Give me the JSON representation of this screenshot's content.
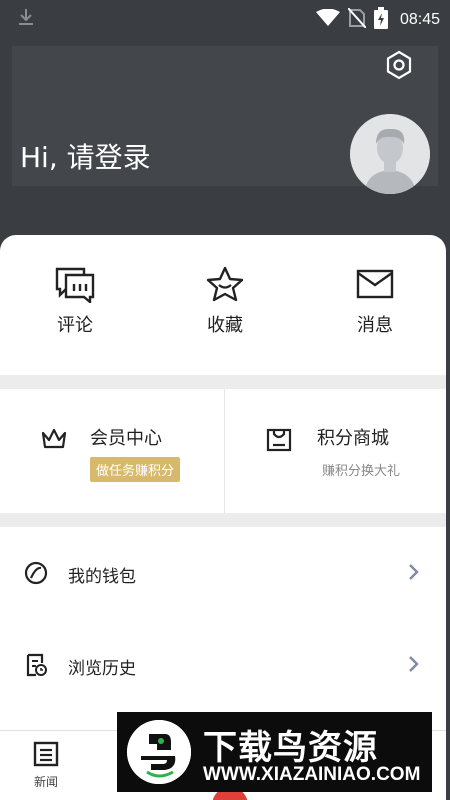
{
  "status_bar": {
    "time": "08:45"
  },
  "header": {
    "greeting": "Hi, 请登录"
  },
  "quick_actions": [
    {
      "label": "评论",
      "icon": "comment-icon"
    },
    {
      "label": "收藏",
      "icon": "star-icon"
    },
    {
      "label": "消息",
      "icon": "mail-icon"
    }
  ],
  "member": {
    "vip": {
      "title": "会员中心",
      "badge": "做任务赚积分",
      "icon": "crown-icon"
    },
    "points_mall": {
      "title": "积分商城",
      "subtitle": "赚积分换大礼",
      "icon": "store-icon"
    }
  },
  "list": [
    {
      "label": "我的钱包",
      "icon": "wallet-icon"
    },
    {
      "label": "浏览历史",
      "icon": "history-icon"
    }
  ],
  "bottom_nav": {
    "news_label": "新闻"
  },
  "watermark": {
    "title": "下载鸟资源",
    "url": "WWW.XIAZAINIAO.COM"
  },
  "colors": {
    "header_bg": "#3a3d42",
    "badge_bg": "#d8b96c",
    "nav_red": "#e0403a"
  }
}
